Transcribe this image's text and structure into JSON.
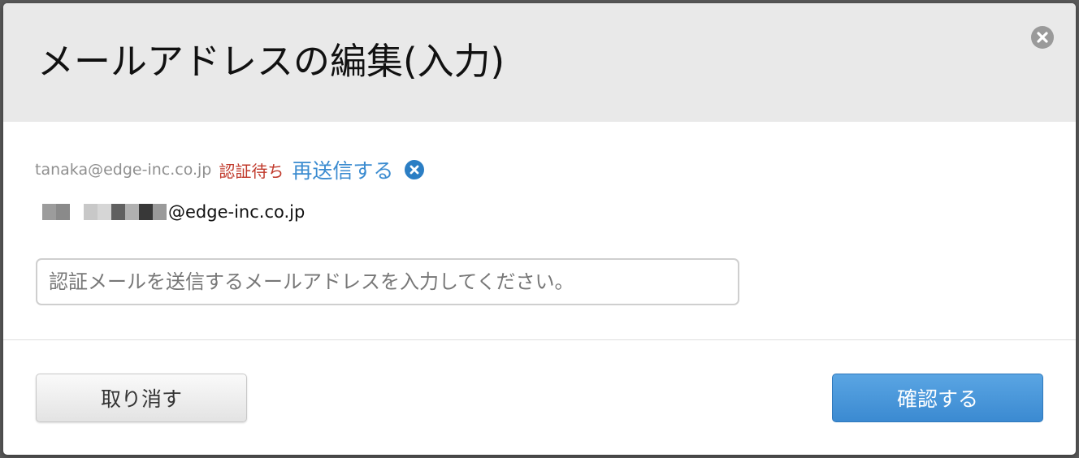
{
  "dialog": {
    "title": "メールアドレスの編集(入力)"
  },
  "pending": {
    "email": "tanaka@edge-inc.co.jp",
    "status": "認証待ち",
    "resend_label": "再送信する",
    "status_color": "#c0392b",
    "link_color": "#3a8bd0"
  },
  "current": {
    "domain": "@edge-inc.co.jp",
    "masked_blocks": [
      "#9c9c9c",
      "#8a8a8a",
      "#ffffff",
      "#c8c8c8",
      "#d6d6d6",
      "#606060",
      "#b0b0b0",
      "#383838",
      "#9a9a9a"
    ]
  },
  "input": {
    "value": "",
    "placeholder": "認証メールを送信するメールアドレスを入力してください。"
  },
  "footer": {
    "cancel_label": "取り消す",
    "confirm_label": "確認する",
    "confirm_color": "#4a97da"
  },
  "icons": {
    "close": "close-icon",
    "cancel_pending": "close-circle-icon"
  }
}
